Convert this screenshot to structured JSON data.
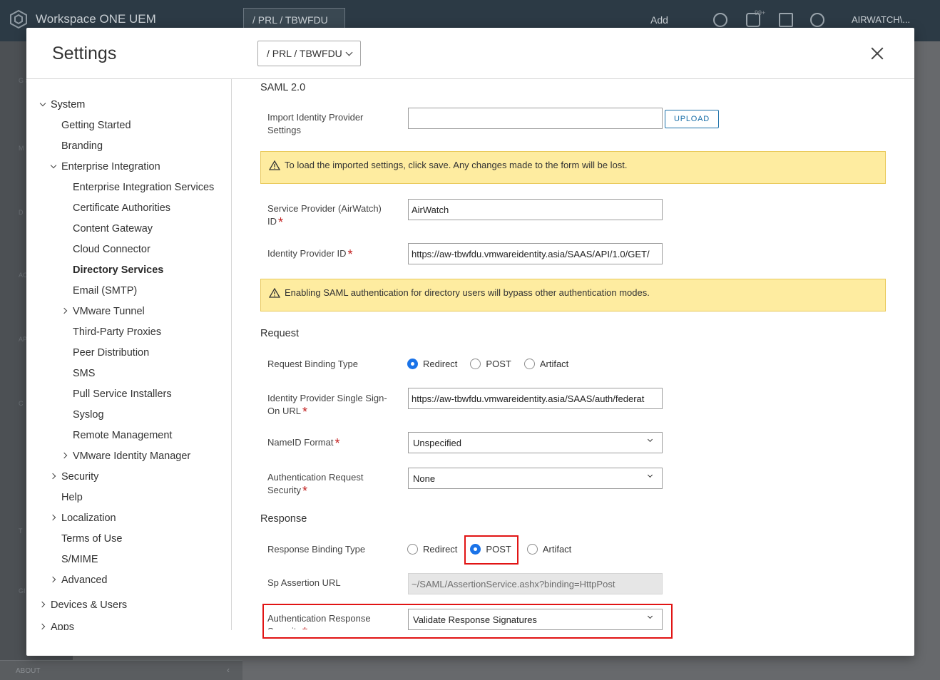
{
  "background": {
    "brand": "Workspace ONE UEM",
    "og": "/ PRL / TBWFDU",
    "add": "Add",
    "user": "AIRWATCH\\...",
    "notification_count": "99+",
    "about": "ABOUT",
    "leftnav": [
      "G S",
      "M",
      "D",
      "AC",
      "APP",
      "C",
      "T",
      "GI S"
    ]
  },
  "modal": {
    "title": "Settings",
    "og_selector": "/ PRL / TBWFDU"
  },
  "sidebar": {
    "system": "System",
    "getting_started": "Getting Started",
    "branding": "Branding",
    "enterprise_integration": "Enterprise Integration",
    "ei_services": "Enterprise Integration Services",
    "certificate_authorities": "Certificate Authorities",
    "content_gateway": "Content Gateway",
    "cloud_connector": "Cloud Connector",
    "directory_services": "Directory Services",
    "email_smtp": "Email (SMTP)",
    "vmware_tunnel": "VMware Tunnel",
    "third_party_proxies": "Third-Party Proxies",
    "peer_distribution": "Peer Distribution",
    "sms": "SMS",
    "pull_service_installers": "Pull Service Installers",
    "syslog": "Syslog",
    "remote_management": "Remote Management",
    "vmware_identity_manager": "VMware Identity Manager",
    "security": "Security",
    "help": "Help",
    "localization": "Localization",
    "terms_of_use": "Terms of Use",
    "smime": "S/MIME",
    "advanced": "Advanced",
    "devices_users": "Devices & Users",
    "apps": "Apps"
  },
  "form": {
    "saml_heading": "SAML 2.0",
    "import_label": "Import Identity Provider Settings",
    "import_value": "",
    "upload_label": "UPLOAD",
    "alert_import": "To load the imported settings, click save. Any changes made to the form will be lost.",
    "sp_id_label": "Service Provider (AirWatch) ID",
    "sp_id_value": "AirWatch",
    "idp_id_label": "Identity Provider ID",
    "idp_id_value": "https://aw-tbwfdu.vmwareidentity.asia/SAAS/API/1.0/GET/",
    "alert_saml": "Enabling SAML authentication for directory users will bypass other authentication modes.",
    "request_heading": "Request",
    "req_binding_label": "Request Binding Type",
    "req_binding_options": [
      "Redirect",
      "POST",
      "Artifact"
    ],
    "req_binding_selected": "Redirect",
    "idp_sso_label": "Identity Provider Single Sign-On URL",
    "idp_sso_value": "https://aw-tbwfdu.vmwareidentity.asia/SAAS/auth/federat",
    "nameid_label": "NameID Format",
    "nameid_value": "Unspecified",
    "auth_req_sec_label": "Authentication Request Security",
    "auth_req_sec_value": "None",
    "response_heading": "Response",
    "resp_binding_label": "Response Binding Type",
    "resp_binding_options": [
      "Redirect",
      "POST",
      "Artifact"
    ],
    "resp_binding_selected": "POST",
    "sp_assertion_label": "Sp Assertion URL",
    "sp_assertion_value": "~/SAML/AssertionService.ashx?binding=HttpPost",
    "auth_resp_sec_label": "Authentication Response Security",
    "auth_resp_sec_value": "Validate Response Signatures"
  },
  "colors": {
    "accent": "#1a73e8",
    "alert_bg": "#feeca0",
    "highlight": "#e11414",
    "required": "#c21f1f"
  }
}
